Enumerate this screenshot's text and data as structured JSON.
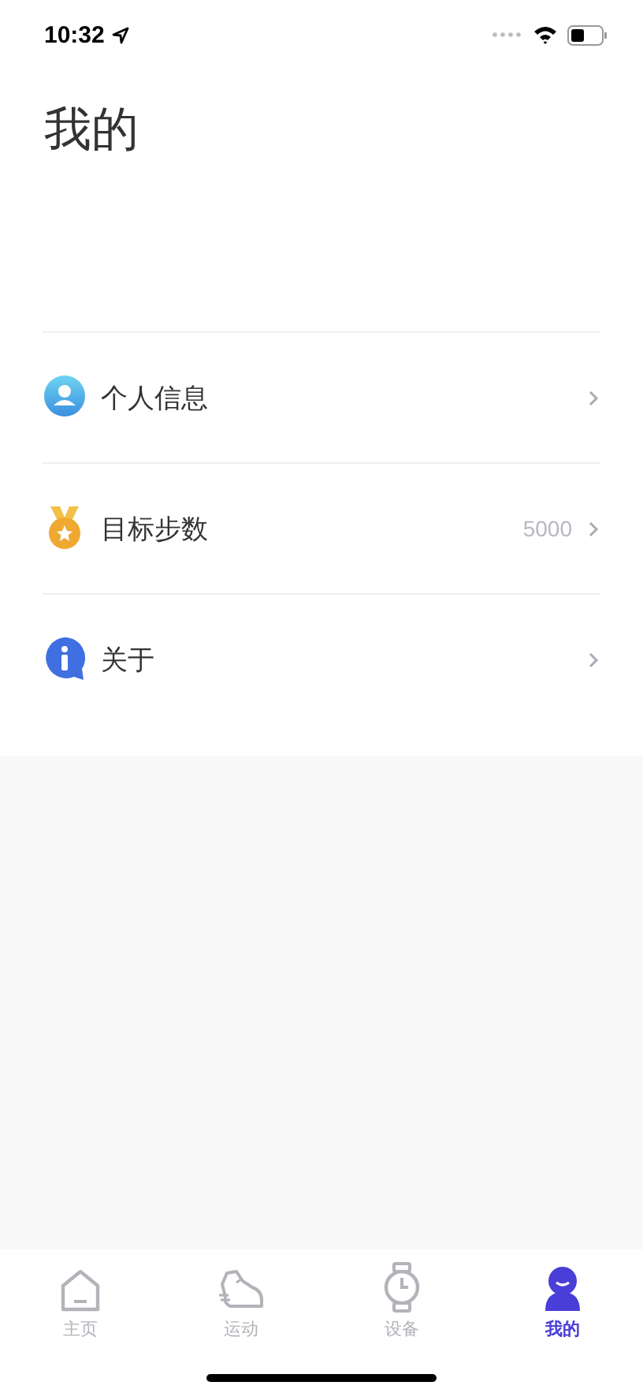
{
  "status_bar": {
    "time": "10:32"
  },
  "title": "我的",
  "menu": [
    {
      "kind": "person",
      "label": "个人信息"
    },
    {
      "kind": "medal",
      "label": "目标步数",
      "value": "5000"
    },
    {
      "kind": "info",
      "label": "关于"
    }
  ],
  "tabs": [
    {
      "kind": "home",
      "label": "主页",
      "selected": false
    },
    {
      "kind": "shoe",
      "label": "运动",
      "selected": false
    },
    {
      "kind": "watch",
      "label": "设备",
      "selected": false
    },
    {
      "kind": "me",
      "label": "我的",
      "selected": true
    }
  ]
}
